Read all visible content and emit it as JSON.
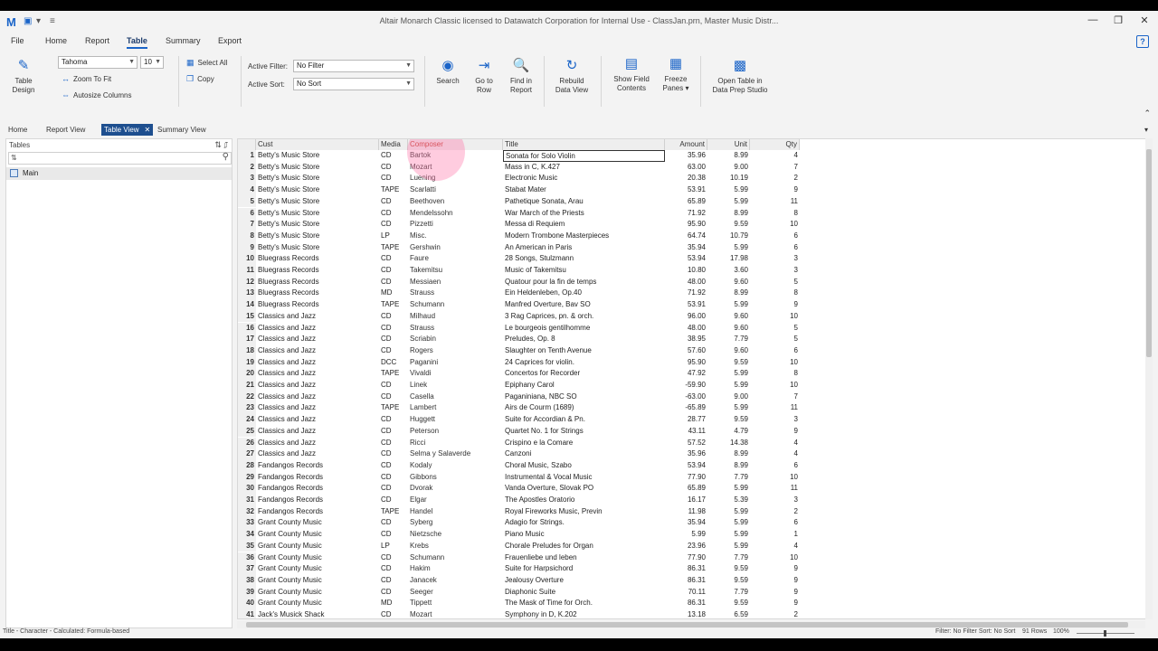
{
  "window": {
    "title": "Altair Monarch Classic licensed to Datawatch Corporation for Internal Use - ClassJan.prn, Master Music Distr...",
    "logo": "M"
  },
  "ribbon_tabs": [
    "File",
    "Home",
    "Report",
    "Table",
    "Summary",
    "Export"
  ],
  "ribbon": {
    "table_design": "Table Design",
    "font_name": "Tahoma",
    "font_size": "10",
    "zoom_to_fit": "Zoom To Fit",
    "autosize_columns": "Autosize Columns",
    "select_all": "Select All",
    "copy": "Copy",
    "active_filter_label": "Active Filter:",
    "active_filter_value": "No Filter",
    "active_sort_label": "Active Sort:",
    "active_sort_value": "No Sort",
    "search": "Search",
    "go_to_row": "Go to Row",
    "find_in_report": "Find in Report",
    "rebuild_data_view": "Rebuild Data View",
    "show_field_contents": "Show Field Contents",
    "freeze_panes": "Freeze Panes",
    "open_table": "Open Table in Data Prep Studio"
  },
  "doc_tabs": [
    "Home",
    "Report View",
    "Table View",
    "Summary View"
  ],
  "tables_panel": {
    "header": "Tables",
    "items": [
      "Main"
    ]
  },
  "grid": {
    "columns": [
      "Cust",
      "Media",
      "Composer",
      "Title",
      "Amount",
      "Unit",
      "Qty"
    ],
    "rows": [
      [
        "1",
        "Betty's Music Store",
        "CD",
        "Bartok",
        "Sonata for Solo Violin",
        "35.96",
        "8.99",
        "4"
      ],
      [
        "2",
        "Betty's Music Store",
        "CD",
        "Mozart",
        "Mass in C, K.427",
        "63.00",
        "9.00",
        "7"
      ],
      [
        "3",
        "Betty's Music Store",
        "CD",
        "Luening",
        "Electronic Music",
        "20.38",
        "10.19",
        "2"
      ],
      [
        "4",
        "Betty's Music Store",
        "TAPE",
        "Scarlatti",
        "Stabat Mater",
        "53.91",
        "5.99",
        "9"
      ],
      [
        "5",
        "Betty's Music Store",
        "CD",
        "Beethoven",
        "Pathetique Sonata, Arau",
        "65.89",
        "5.99",
        "11"
      ],
      [
        "6",
        "Betty's Music Store",
        "CD",
        "Mendelssohn",
        "War March of the Priests",
        "71.92",
        "8.99",
        "8"
      ],
      [
        "7",
        "Betty's Music Store",
        "CD",
        "Pizzetti",
        "Messa di Requiem",
        "95.90",
        "9.59",
        "10"
      ],
      [
        "8",
        "Betty's Music Store",
        "LP",
        "Misc.",
        "Modern Trombone Masterpieces",
        "64.74",
        "10.79",
        "6"
      ],
      [
        "9",
        "Betty's Music Store",
        "TAPE",
        "Gershwin",
        "An American in Paris",
        "35.94",
        "5.99",
        "6"
      ],
      [
        "10",
        "Bluegrass Records",
        "CD",
        "Faure",
        "28 Songs, Stulzmann",
        "53.94",
        "17.98",
        "3"
      ],
      [
        "11",
        "Bluegrass Records",
        "CD",
        "Takemitsu",
        "Music of Takemitsu",
        "10.80",
        "3.60",
        "3"
      ],
      [
        "12",
        "Bluegrass Records",
        "CD",
        "Messiaen",
        "Quatour pour la fin de temps",
        "48.00",
        "9.60",
        "5"
      ],
      [
        "13",
        "Bluegrass Records",
        "MD",
        "Strauss",
        "Ein Heldenleben, Op.40",
        "71.92",
        "8.99",
        "8"
      ],
      [
        "14",
        "Bluegrass Records",
        "TAPE",
        "Schumann",
        "Manfred Overture, Bav SO",
        "53.91",
        "5.99",
        "9"
      ],
      [
        "15",
        "Classics and Jazz",
        "CD",
        "Milhaud",
        "3 Rag Caprices, pn. & orch.",
        "96.00",
        "9.60",
        "10"
      ],
      [
        "16",
        "Classics and Jazz",
        "CD",
        "Strauss",
        "Le bourgeois gentilhomme",
        "48.00",
        "9.60",
        "5"
      ],
      [
        "17",
        "Classics and Jazz",
        "CD",
        "Scriabin",
        "Preludes, Op. 8",
        "38.95",
        "7.79",
        "5"
      ],
      [
        "18",
        "Classics and Jazz",
        "CD",
        "Rogers",
        "Slaughter on Tenth Avenue",
        "57.60",
        "9.60",
        "6"
      ],
      [
        "19",
        "Classics and Jazz",
        "DCC",
        "Paganini",
        "24 Caprices for violin.",
        "95.90",
        "9.59",
        "10"
      ],
      [
        "20",
        "Classics and Jazz",
        "TAPE",
        "Vivaldi",
        "Concertos for Recorder",
        "47.92",
        "5.99",
        "8"
      ],
      [
        "21",
        "Classics and Jazz",
        "CD",
        "Linek",
        "Epiphany Carol",
        "-59.90",
        "5.99",
        "10"
      ],
      [
        "22",
        "Classics and Jazz",
        "CD",
        "Casella",
        "Paganiniana, NBC SO",
        "-63.00",
        "9.00",
        "7"
      ],
      [
        "23",
        "Classics and Jazz",
        "TAPE",
        "Lambert",
        "Airs de Courm (1689)",
        "-65.89",
        "5.99",
        "11"
      ],
      [
        "24",
        "Classics and Jazz",
        "CD",
        "Huggett",
        "Suite for Accordian & Pn.",
        "28.77",
        "9.59",
        "3"
      ],
      [
        "25",
        "Classics and Jazz",
        "CD",
        "Peterson",
        "Quartet No. 1 for Strings",
        "43.11",
        "4.79",
        "9"
      ],
      [
        "26",
        "Classics and Jazz",
        "CD",
        "Ricci",
        "Crispino e la Comare",
        "57.52",
        "14.38",
        "4"
      ],
      [
        "27",
        "Classics and Jazz",
        "CD",
        "Selma y Salaverde",
        "Canzoni",
        "35.96",
        "8.99",
        "4"
      ],
      [
        "28",
        "Fandangos Records",
        "CD",
        "Kodaly",
        "Choral Music, Szabo",
        "53.94",
        "8.99",
        "6"
      ],
      [
        "29",
        "Fandangos Records",
        "CD",
        "Gibbons",
        "Instrumental & Vocal Music",
        "77.90",
        "7.79",
        "10"
      ],
      [
        "30",
        "Fandangos Records",
        "CD",
        "Dvorak",
        "Vanda Overture, Slovak PO",
        "65.89",
        "5.99",
        "11"
      ],
      [
        "31",
        "Fandangos Records",
        "CD",
        "Elgar",
        "The Apostles Oratorio",
        "16.17",
        "5.39",
        "3"
      ],
      [
        "32",
        "Fandangos Records",
        "TAPE",
        "Handel",
        "Royal Fireworks Music, Previn",
        "11.98",
        "5.99",
        "2"
      ],
      [
        "33",
        "Grant County Music",
        "CD",
        "Syberg",
        "Adagio for Strings.",
        "35.94",
        "5.99",
        "6"
      ],
      [
        "34",
        "Grant County Music",
        "CD",
        "Nietzsche",
        "Piano Music",
        "5.99",
        "5.99",
        "1"
      ],
      [
        "35",
        "Grant County Music",
        "LP",
        "Krebs",
        "Chorale Preludes for Organ",
        "23.96",
        "5.99",
        "4"
      ],
      [
        "36",
        "Grant County Music",
        "CD",
        "Schumann",
        "Frauenliebe und leben",
        "77.90",
        "7.79",
        "10"
      ],
      [
        "37",
        "Grant County Music",
        "CD",
        "Hakim",
        "Suite for Harpsichord",
        "86.31",
        "9.59",
        "9"
      ],
      [
        "38",
        "Grant County Music",
        "CD",
        "Janacek",
        "Jealousy Overture",
        "86.31",
        "9.59",
        "9"
      ],
      [
        "39",
        "Grant County Music",
        "CD",
        "Seeger",
        "Diaphonic Suite",
        "70.11",
        "7.79",
        "9"
      ],
      [
        "40",
        "Grant County Music",
        "MD",
        "Tippett",
        "The Mask of Time for Orch.",
        "86.31",
        "9.59",
        "9"
      ],
      [
        "41",
        "Jack's Musick Shack",
        "CD",
        "Mozart",
        "Symphony in D, K.202",
        "13.18",
        "6.59",
        "2"
      ]
    ]
  },
  "status": {
    "left": "Title - Character - Calculated: Formula-based",
    "filter_sort": "Filter: No Filter  Sort: No Sort",
    "rows": "91 Rows",
    "zoom": "100%"
  },
  "colors": {
    "accent": "#1a64c8",
    "active_tab": "#1e4f8f",
    "composer_header": "#c0392b"
  }
}
